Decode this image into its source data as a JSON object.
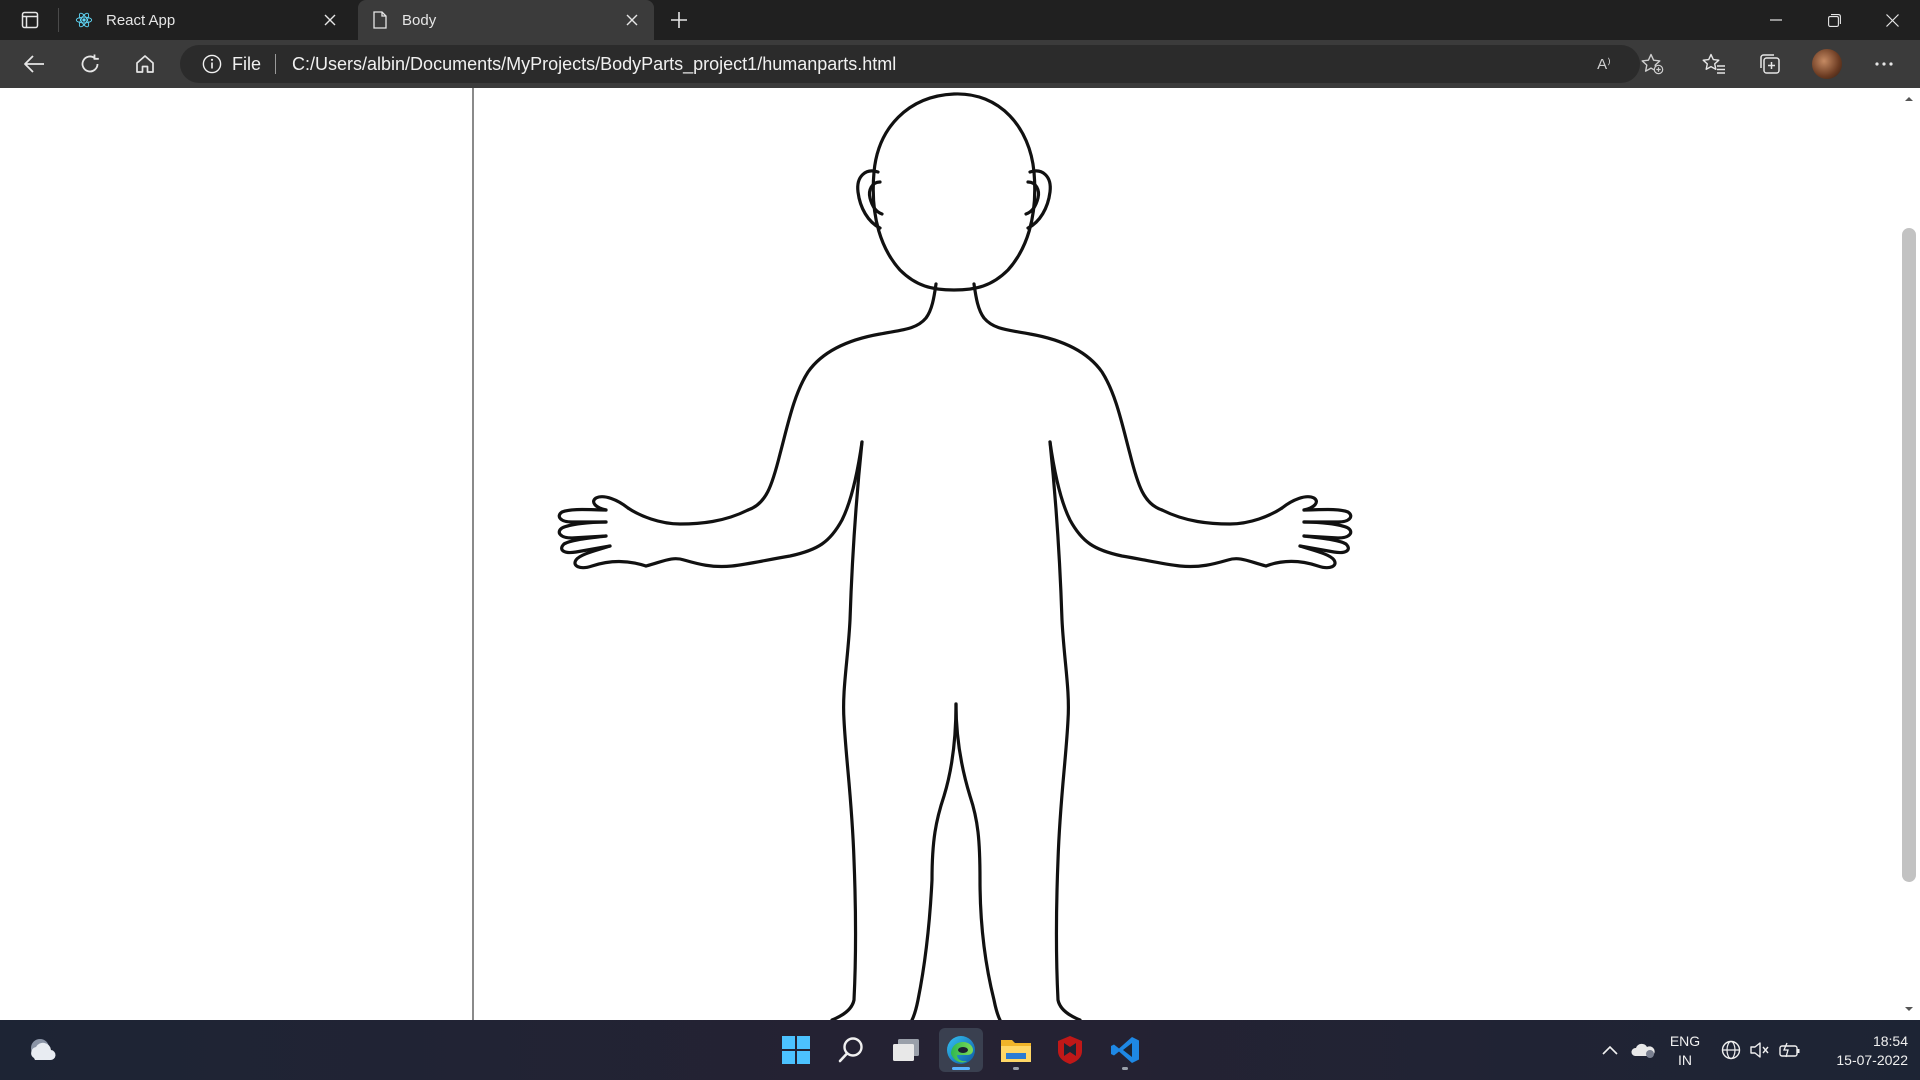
{
  "browser": {
    "tabs": [
      {
        "title": "React App",
        "icon": "react-icon",
        "active": false
      },
      {
        "title": "Body",
        "icon": "file-icon",
        "active": true
      }
    ],
    "address": {
      "scheme": "File",
      "url": "C:/Users/albin/Documents/MyProjects/BodyParts_project1/humanparts.html"
    },
    "read_aloud_label": "A⁾"
  },
  "taskbar": {
    "apps": [
      "start-icon",
      "search-icon",
      "task-view-icon",
      "edge-icon",
      "file-explorer-icon",
      "mcafee-icon",
      "vscode-icon"
    ],
    "language": {
      "line1": "ENG",
      "line2": "IN"
    },
    "clock": {
      "time": "18:54",
      "date": "15-07-2022"
    }
  },
  "colors": {
    "tabstrip": "#202020",
    "toolbar": "#3b3b3b",
    "taskbar": "#1d2434",
    "accent": "#59b3ff"
  }
}
